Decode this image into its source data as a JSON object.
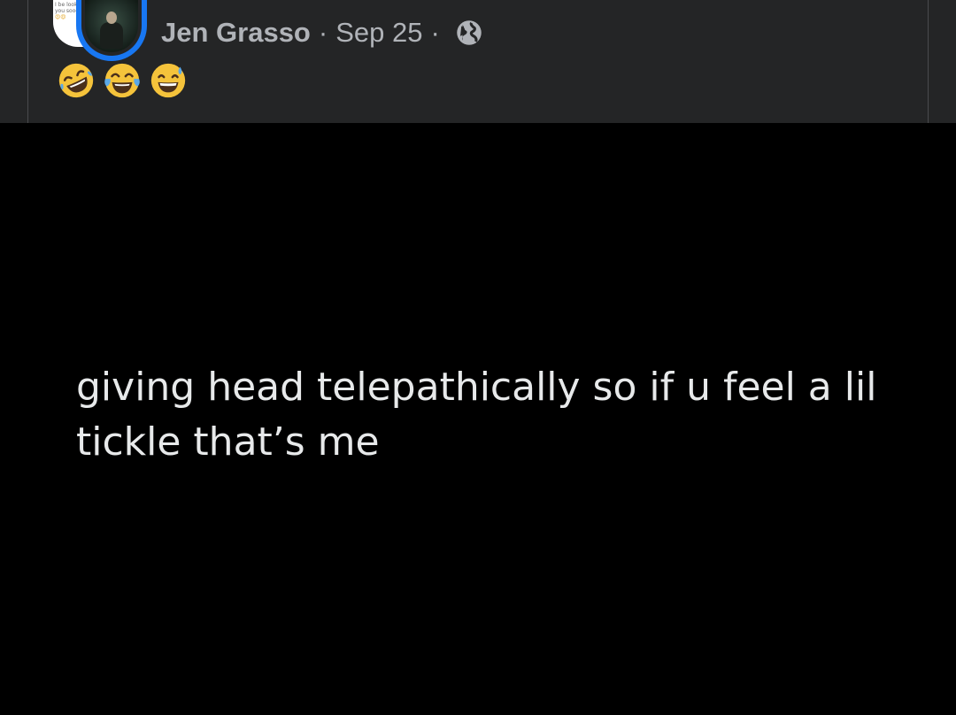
{
  "post": {
    "author": "Jen Grasso",
    "separator": "·",
    "date": "Sep 25",
    "privacy_icon": "globe-icon",
    "thumbnail_text_line1": "I be looking",
    "thumbnail_text_line2": "you soooo",
    "thumbnail_emoji": "😍😍"
  },
  "reactions": [
    {
      "icon": "rolling-on-floor-laughing-emoji",
      "glyph": "🤣"
    },
    {
      "icon": "tears-of-joy-emoji",
      "glyph": "😂"
    },
    {
      "icon": "grinning-sweat-emoji",
      "glyph": "😅"
    }
  ],
  "tweet": {
    "line1": "giving head telepathically so if u feel a lil",
    "line2": "tickle that’s me"
  },
  "colors": {
    "header_bg": "#242526",
    "meta_text": "#b0b3b8",
    "story_ring": "#1877f2",
    "tweet_bg": "#000000",
    "tweet_text": "#e7e9ea"
  }
}
